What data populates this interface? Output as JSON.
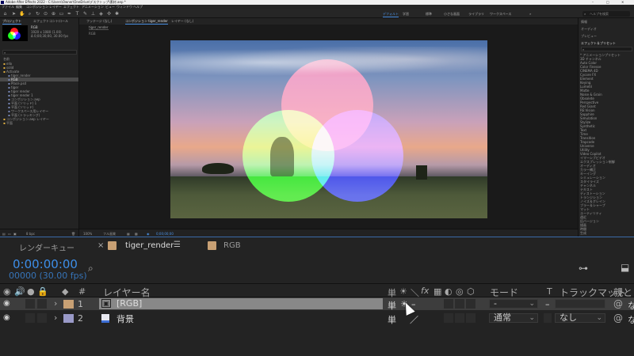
{
  "titlebar": {
    "title": "Adobe After Effects 2022 - C:\\Users\\Owner\\OneDrive\\デスクトップ\\素材.aep *"
  },
  "menubar": {
    "items": [
      "ファイル",
      "編集",
      "コンポジション",
      "レイヤー",
      "エフェクト",
      "アニメーション",
      "ビュー",
      "ウィンドウ",
      "ヘルプ"
    ]
  },
  "workspaces": {
    "items": [
      "デフォルト",
      "学習",
      "標準",
      "小さな画面",
      "ライブラリ",
      "ワークスペース",
      "»"
    ],
    "active": "デフォルト",
    "search": "ヘルプを検索"
  },
  "project_panel": {
    "tabs": [
      "プロジェクト",
      "エフェクトコントロール"
    ],
    "thumb_caption": "RGB",
    "thumb_info": [
      "1920 x 1080 (1.00)",
      "Δ 0;00;30;00, 30.00 fps"
    ],
    "search_placeholder": "",
    "column_name": "名前",
    "tree": [
      "ello",
      "solid",
      "Activate",
      "tiger_render",
      "RGB",
      "Place.psd",
      "tiger",
      "tiger render",
      "tiger render 1",
      "コンポジション.aep",
      "平面 (ソリッド) 1",
      "平面 (ソリッド)",
      "ワークスペース用レイヤー",
      "平面 (トラッキング)",
      "コンポジション.aep レイヤー",
      "平面"
    ],
    "bpc": "8 bpc"
  },
  "viewer_panel": {
    "tabs": [
      "フッテージ (なし)",
      "コンポジション tiger_render",
      "レイヤー (なし)"
    ],
    "comp_label": "tiger_render",
    "sub_label": "RGB",
    "zoom": "100%",
    "quality": "フル画質",
    "timecode": "0;00;00;00"
  },
  "effects_panel": {
    "tabs": [
      "情報",
      "オーディオ",
      "プレビュー",
      "エフェクト＆プリセット"
    ],
    "search_value": "",
    "items": [
      "* アニメーションプリセット",
      "3D チャンネル",
      "Auto Color",
      "Color Finesse",
      "CINEMA 4D",
      "Cycore FX",
      "Element",
      "Keying",
      "Lumetri",
      "Matte",
      "Noise & Grain",
      "Obsolete",
      "Perspective",
      "Red Giant",
      "RE:Vision",
      "Sapphire",
      "Simulation",
      "Stylize",
      "Synthetic",
      "Text",
      "Time",
      "Transition",
      "Trapcode",
      "Universe",
      "Utility",
      "Video Copilot",
      "イマーシブビデオ",
      "エクスプレッション制御",
      "オーディオ",
      "カラー補正",
      "キーイング",
      "シミュレーション",
      "スタイライズ",
      "チャンネル",
      "テキスト",
      "ディストーション",
      "トランジション",
      "ノイズ＆グレイン",
      "ブラー＆シャープ",
      "マット",
      "ユーティリティ",
      "遠近",
      "旧バージョン",
      "描画",
      "時間",
      "生成"
    ]
  },
  "timeline": {
    "tabs": [
      {
        "label": "レンダーキュー"
      },
      {
        "label": "tiger_render",
        "active": true,
        "swatch": "#c8a074"
      },
      {
        "label": "RGB",
        "swatch": "#c8a074"
      }
    ],
    "timecode": "0:00:00:00",
    "frames": "00000 (30.00 fps)",
    "search_placeholder": "",
    "columns": {
      "num": "#",
      "layer_name": "レイヤー名",
      "switches": [
        "単",
        "☀",
        "＼",
        "fx",
        "▦",
        "◐",
        "◎",
        "⬡"
      ],
      "mode": "モード",
      "t": "T",
      "trackmatte": "トラックマット",
      "parent": "親とリ"
    },
    "layers": [
      {
        "num": "1",
        "name": "[RGB]",
        "label_color": "#c8a074",
        "mode": "-",
        "trackmatte": "",
        "selected": true,
        "parent": "な"
      },
      {
        "num": "2",
        "name": "背景",
        "label_color": "#9a9ac8",
        "mode": "通常",
        "trackmatte": "なし",
        "selected": false,
        "parent": "な"
      }
    ]
  },
  "colors": {
    "accent": "#3d8ee8",
    "timecode": "#3d8ee8"
  }
}
